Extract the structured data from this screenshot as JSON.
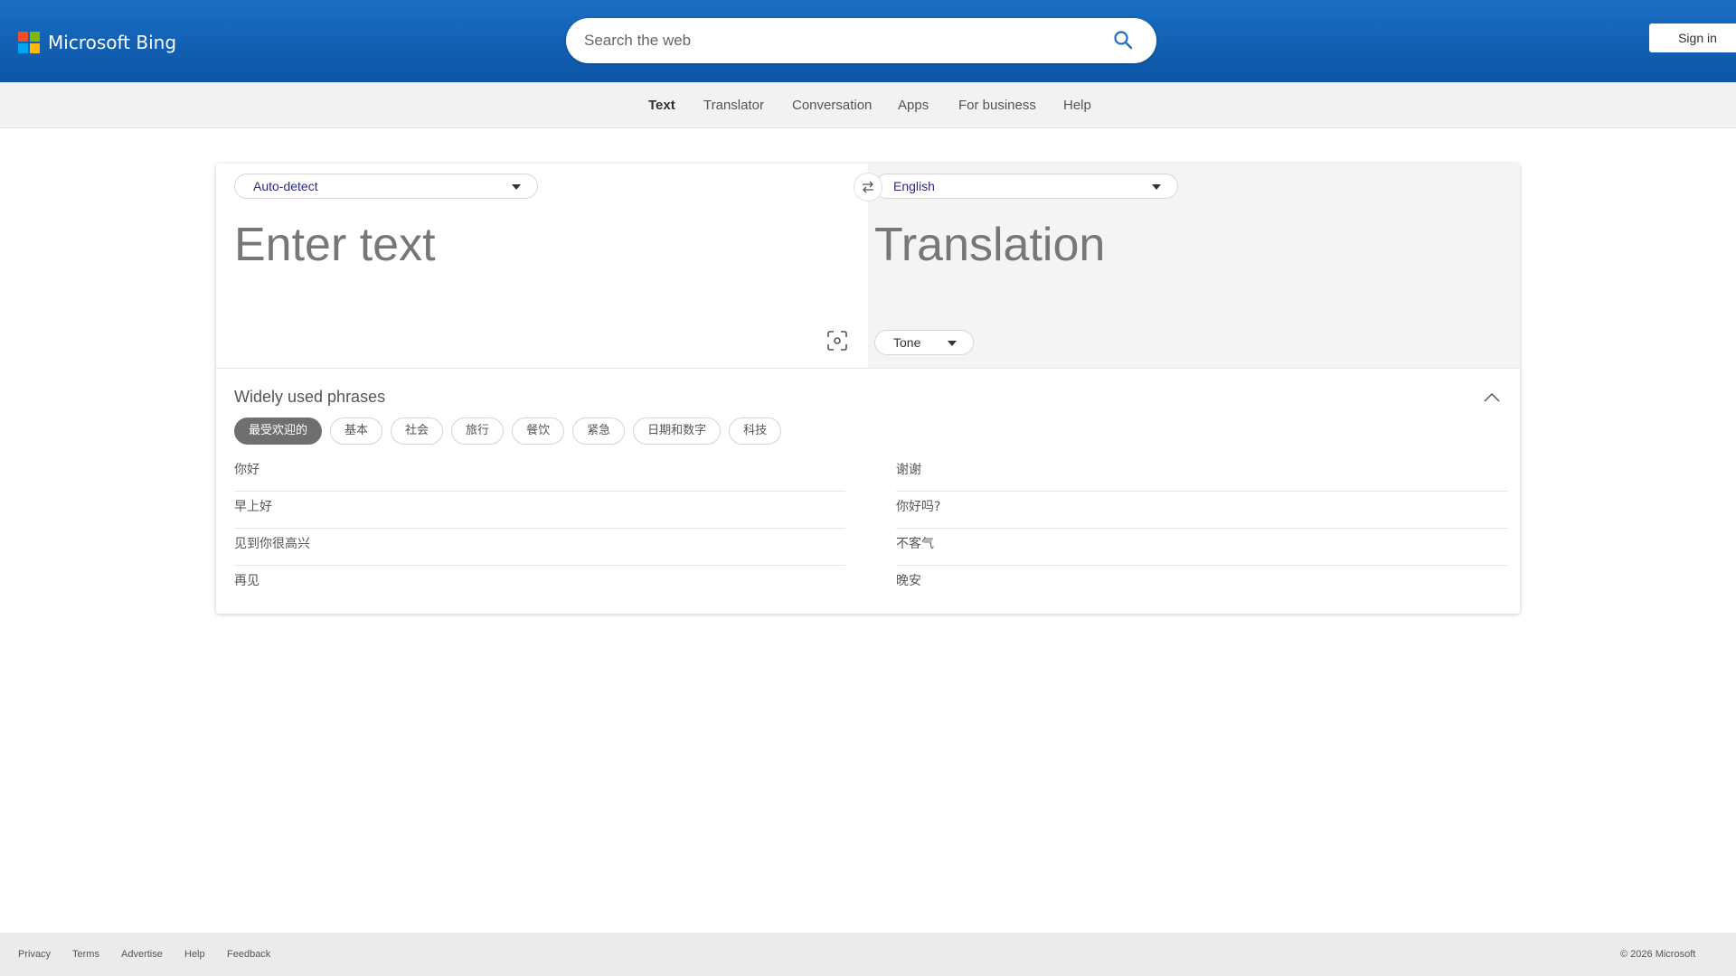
{
  "header": {
    "brand": "Microsoft Bing",
    "search_placeholder": "Search the web",
    "sign_in": "Sign in",
    "logo_colors": [
      "#f25022",
      "#7fba00",
      "#00a4ef",
      "#ffb900"
    ]
  },
  "nav": {
    "items": [
      {
        "label": "Text",
        "active": true
      },
      {
        "label": "Translator"
      },
      {
        "label": "Conversation"
      },
      {
        "label": "Apps"
      },
      {
        "label": "For business"
      },
      {
        "label": "Help"
      }
    ]
  },
  "translator": {
    "source_language": "Auto-detect",
    "target_language": "English",
    "input_placeholder": "Enter text",
    "output_placeholder": "Translation",
    "tone_label": "Tone"
  },
  "phrases": {
    "title": "Widely used phrases",
    "categories": [
      "最受欢迎的",
      "基本",
      "社会",
      "旅行",
      "餐饮",
      "紧急",
      "日期和数字",
      "科技"
    ],
    "active_category": "最受欢迎的",
    "left": [
      "你好",
      "早上好",
      "见到你很高兴",
      "再见"
    ],
    "right": [
      "谢谢",
      "你好吗?",
      "不客气",
      "晚安"
    ]
  },
  "footer": {
    "links": [
      "Privacy",
      "Terms",
      "Advertise",
      "Help",
      "Feedback"
    ],
    "copyright": "© 2026 Microsoft"
  }
}
